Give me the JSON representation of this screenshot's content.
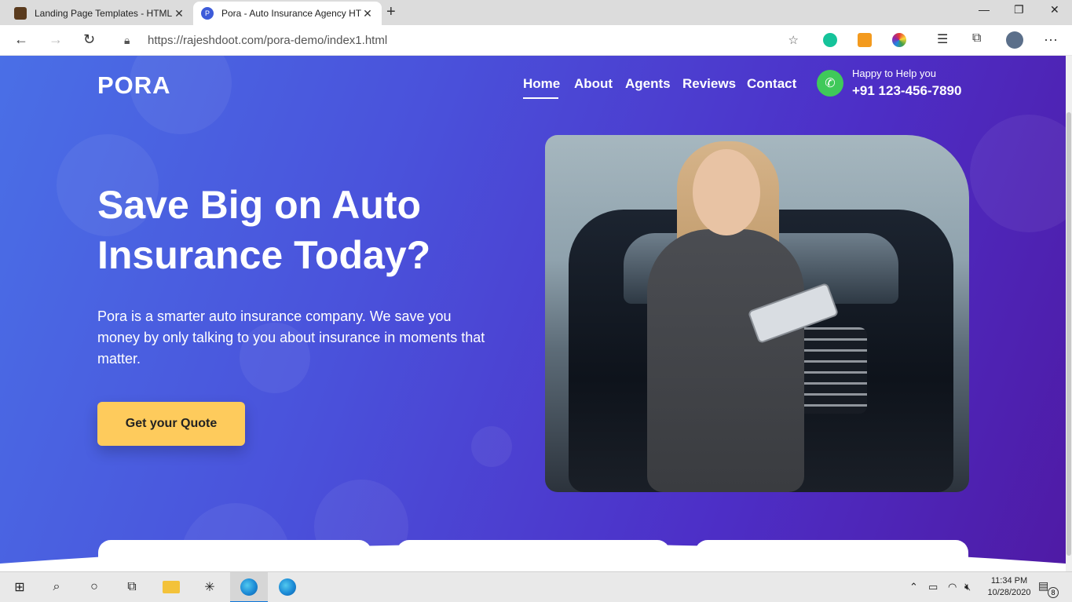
{
  "browser": {
    "tabs": [
      {
        "label": "Landing Page Templates - HTML",
        "active": false
      },
      {
        "label": "Pora - Auto Insurance Agency HT",
        "active": true
      }
    ],
    "new_tab": "+",
    "url": "https://rajeshdoot.com/pora-demo/index1.html",
    "window_controls": {
      "minimize": "—",
      "restore": "❐",
      "close": "✕"
    },
    "nav": {
      "back": "←",
      "forward": "→",
      "refresh": "↻"
    }
  },
  "site": {
    "logo": "PORA",
    "nav": [
      {
        "label": "Home",
        "active": true
      },
      {
        "label": "About",
        "active": false
      },
      {
        "label": "Agents",
        "active": false
      },
      {
        "label": "Reviews",
        "active": false
      },
      {
        "label": "Contact",
        "active": false
      }
    ],
    "contact": {
      "help_text": "Happy to Help you",
      "phone": "+91 123-456-7890"
    },
    "hero": {
      "title_line1": "Save Big on Auto",
      "title_line2": "Insurance Today?",
      "description": "Pora is a smarter auto insurance company. We save you money by only talking to you about insurance in moments that matter.",
      "cta": "Get your Quote"
    },
    "colors": {
      "gradient_start": "#4a6fe6",
      "gradient_end": "#4f1aa5",
      "cta_bg": "#fecb5c",
      "phone_icon_bg": "#3fc95a"
    }
  },
  "taskbar": {
    "time": "11:34 PM",
    "date": "10/28/2020",
    "notification_count": "8"
  }
}
